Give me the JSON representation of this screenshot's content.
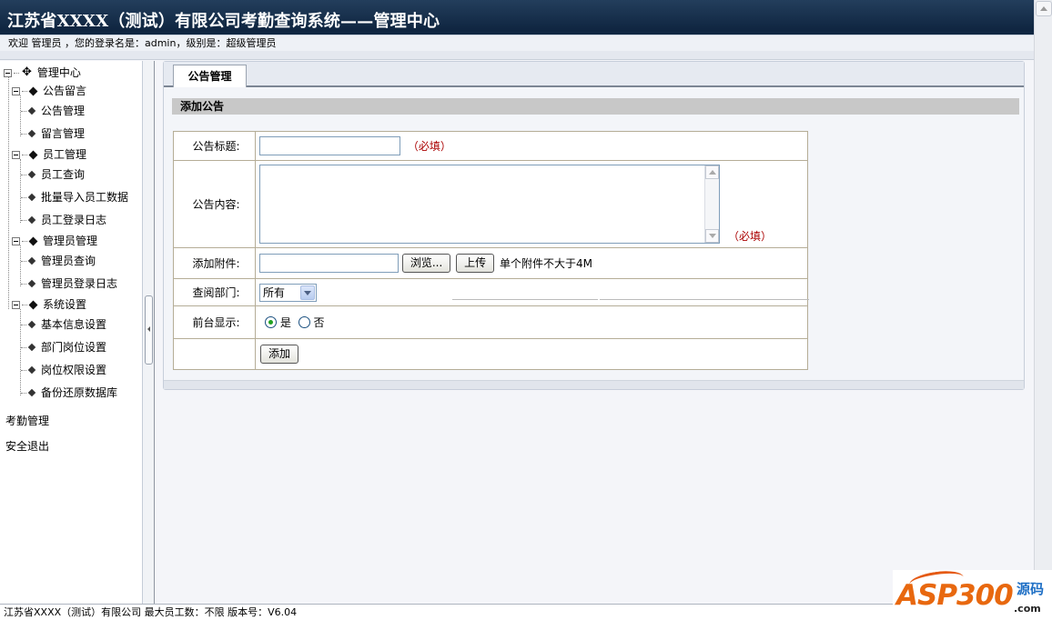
{
  "header": {
    "title": "江苏省XXXX（测试）有限公司考勤查询系统——管理中心",
    "welcome": "欢迎 管理员 ，您的登录名是：admin，级别是：超级管理员"
  },
  "menu": {
    "root": "管理中心",
    "groups": [
      {
        "label": "公告留言",
        "items": [
          "公告管理",
          "留言管理"
        ]
      },
      {
        "label": "员工管理",
        "items": [
          "员工查询",
          "批量导入员工数据",
          "员工登录日志"
        ]
      },
      {
        "label": "管理员管理",
        "items": [
          "管理员查询",
          "管理员登录日志"
        ]
      },
      {
        "label": "系统设置",
        "items": [
          "基本信息设置",
          "部门岗位设置",
          "岗位权限设置",
          "备份还原数据库"
        ]
      }
    ],
    "links": [
      "考勤管理",
      "安全退出"
    ]
  },
  "main": {
    "tab": "公告管理",
    "section_title": "添加公告",
    "form": {
      "title_label": "公告标题:",
      "title_value": "",
      "required": "（必填）",
      "content_label": "公告内容:",
      "content_value": "",
      "attachment_label": "添加附件:",
      "browse_button": "浏览...",
      "upload_button": "上传",
      "attachment_note": "单个附件不大于4M",
      "dept_label": "查阅部门:",
      "dept_selected": "所有",
      "frontend_label": "前台显示:",
      "option_yes": "是",
      "option_no": "否",
      "frontend_selected": "是",
      "submit_button": "添加"
    }
  },
  "statusbar": {
    "text": "江苏省XXXX（测试）有限公司  最大员工数：不限  版本号：V6.04"
  },
  "watermark": {
    "brand": "ASP300",
    "brand_cn": "源码",
    "domain": ".com"
  },
  "colors": {
    "header_bg": "#0f2540",
    "required_text": "#aa0000",
    "section_bar": "#c8c8c8",
    "table_border": "#b5ad97",
    "logo_orange": "#e8680f",
    "logo_blue": "#1e6fc5"
  }
}
